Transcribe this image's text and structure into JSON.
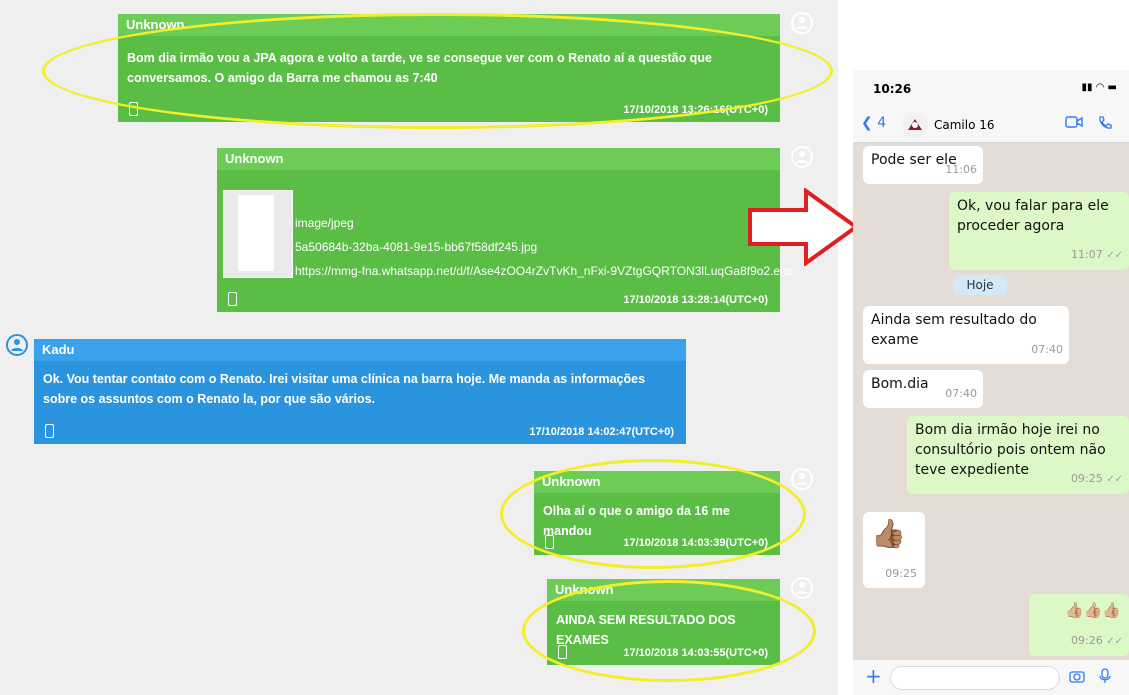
{
  "left_panel": {
    "messages": [
      {
        "sender": "Unknown",
        "text": "Bom dia irmão vou a JPA agora e volto a tarde, ve se consegue ver com o Renato aí a questão que conversamos. O amigo da Barra me chamou as 7:40",
        "timestamp": "17/10/2018 13:26:16(UTC+0)"
      },
      {
        "sender": "Unknown",
        "attachment": {
          "type": "image/jpeg",
          "filename": "5a50684b-32ba-4081-9e15-bb67f58df245.jpg",
          "url": "https://mmg-fna.whatsapp.net/d/f/Ase4zOO4rZvTvKh_nFxi-9VZtgGQRTON3lLuqGa8f9o2.enc"
        },
        "timestamp": "17/10/2018 13:28:14(UTC+0)"
      },
      {
        "sender": "Kadu",
        "text": "Ok. Vou tentar contato com o Renato. Irei visitar uma clínica na barra hoje. Me manda as informações sobre os assuntos com o Renato la, por que são vários.",
        "timestamp": "17/10/2018 14:02:47(UTC+0)"
      },
      {
        "sender": "Unknown",
        "text": "Olha aí o que o amigo da 16 me mandou",
        "timestamp": "17/10/2018 14:03:39(UTC+0)"
      },
      {
        "sender": "Unknown",
        "text": "AINDA SEM RESULTADO DOS EXAMES",
        "timestamp": "17/10/2018 14:03:55(UTC+0)"
      }
    ]
  },
  "phone": {
    "status_time": "10:26",
    "back_count": "4",
    "chat_name": "Camilo 16",
    "day_label": "Hoje",
    "messages": [
      {
        "text": "Pode ser ele",
        "time": "11:06"
      },
      {
        "text": "Ok, vou falar para ele proceder agora",
        "time": "11:07"
      },
      {
        "text": "Ainda sem resultado do exame",
        "time": "07:40"
      },
      {
        "text": "Bom.dia",
        "time": "07:40"
      },
      {
        "text": "Bom dia irmão hoje irei no consultório pois ontem não teve expediente",
        "time": "09:25"
      },
      {
        "text": "👍🏽",
        "time": "09:25"
      },
      {
        "text": "👍🏼👍🏼👍🏼",
        "time": "09:26"
      }
    ]
  },
  "colors": {
    "green_bubble": "#5abd45",
    "blue_bubble": "#2b94de",
    "highlight": "#f3ee2a",
    "arrow": "#e02020"
  }
}
